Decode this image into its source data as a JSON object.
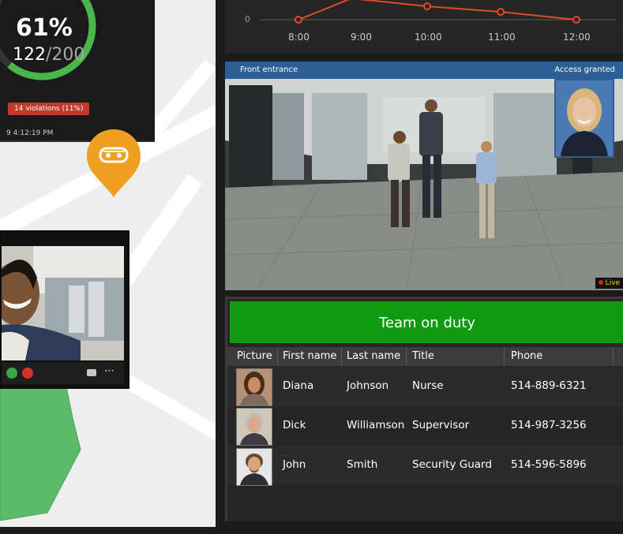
{
  "occupancy": {
    "percent_text": "61%",
    "count": "122",
    "total": "/200",
    "progress": 0.61,
    "violations": "14 violations (11%)",
    "timestamp": "9 4:12:19 PM",
    "ring_color": "#49b54a"
  },
  "timeline": {
    "zero_label": "0",
    "ticks": [
      "8:00",
      "9:00",
      "10:00",
      "11:00",
      "12:00"
    ],
    "line_color": "#e04a2a"
  },
  "camera": {
    "title": "Front entrance",
    "status": "Access granted",
    "live": "Live",
    "bar_color": "#2c5f96"
  },
  "pin": {
    "icon": "vehicle-icon",
    "color": "#f0a021"
  },
  "team": {
    "title": "Team on duty",
    "header_color": "#0e9b12",
    "columns": [
      "Picture",
      "First name",
      "Last name",
      "Title",
      "Phone"
    ],
    "rows": [
      {
        "first": "Diana",
        "last": "Johnson",
        "title": "Nurse",
        "phone": "514-889-6321"
      },
      {
        "first": "Dick",
        "last": "Williamson",
        "title": "Supervisor",
        "phone": "514-987-3256"
      },
      {
        "first": "John",
        "last": "Smith",
        "title": "Security Guard",
        "phone": "514-596-5896"
      }
    ]
  }
}
